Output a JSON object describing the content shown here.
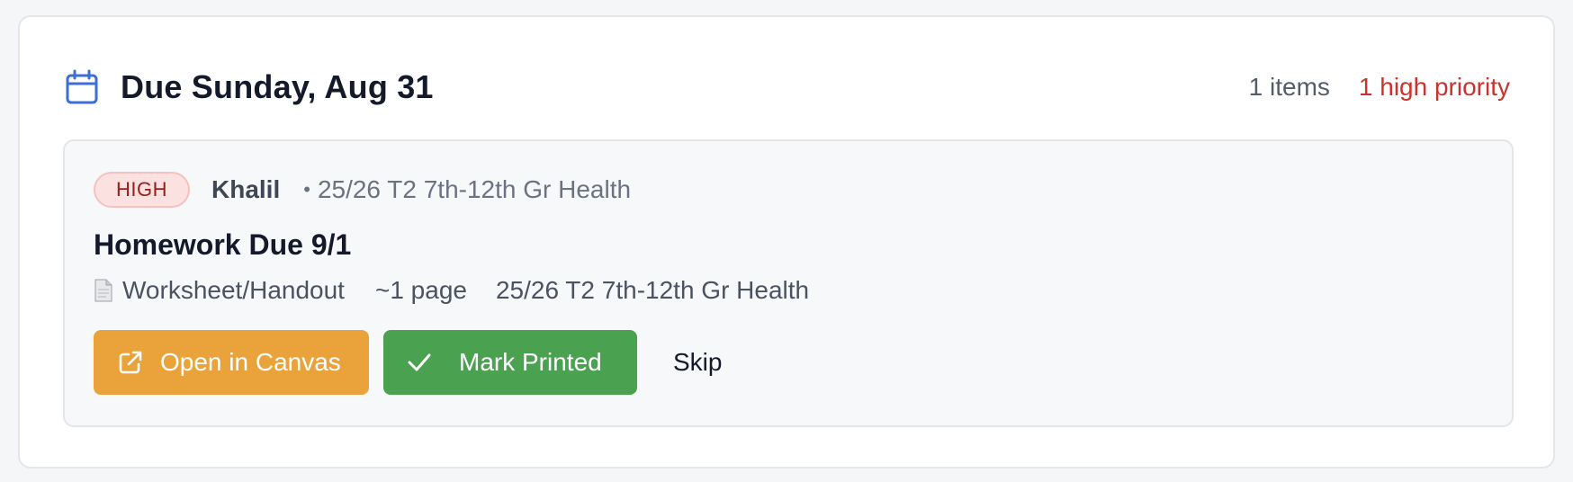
{
  "header": {
    "icon": "calendar-icon",
    "title": "Due Sunday, Aug 31",
    "items_count": "1 items",
    "high_priority": "1 high priority"
  },
  "colors": {
    "accent_blue": "#3b6fd8",
    "high_red": "#c8342c",
    "open_orange": "#e9a33a",
    "mark_green": "#4aa150"
  },
  "item": {
    "priority": "HIGH",
    "student": "Khalil",
    "separator": "•",
    "course": "25/26 T2 7th-12th Gr Health",
    "title": "Homework Due 9/1",
    "doc_icon": "document-icon",
    "type": "Worksheet/Handout",
    "pages": "~1 page",
    "course_detail": "25/26 T2 7th-12th Gr Health"
  },
  "actions": {
    "open_label": "Open in Canvas",
    "open_icon": "external-link-icon",
    "mark_label": "Mark Printed",
    "mark_icon": "checkmark-icon",
    "skip_label": "Skip"
  }
}
